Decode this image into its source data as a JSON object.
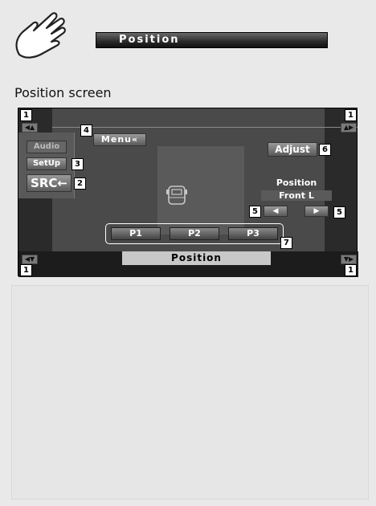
{
  "header": {
    "title": "Position"
  },
  "section": {
    "title": "Position screen"
  },
  "screen": {
    "menu_label": "Menu«",
    "audio_label": "Audio",
    "setup_label": "SetUp",
    "src_label": "SRC←",
    "adjust_label": "Adjust",
    "position_label": "Position",
    "position_value": "Front L",
    "presets": [
      "P1",
      "P2",
      "P3"
    ],
    "status_label": "Position",
    "callouts": {
      "c1": "1",
      "c2": "2",
      "c3": "3",
      "c4": "4",
      "c5": "5",
      "c6": "6",
      "c7": "7"
    }
  },
  "colors": {
    "screen_bg": "#2a2a2a",
    "panel_bg": "#4a4a4a",
    "button_gradient_top": "#9a9a9a",
    "page_bg": "#e9e9e9"
  },
  "icons": {
    "hand": "pointing-hand-icon",
    "car": "car-top-view-icon",
    "left": "arrow-left-icon",
    "right": "arrow-right-icon"
  }
}
